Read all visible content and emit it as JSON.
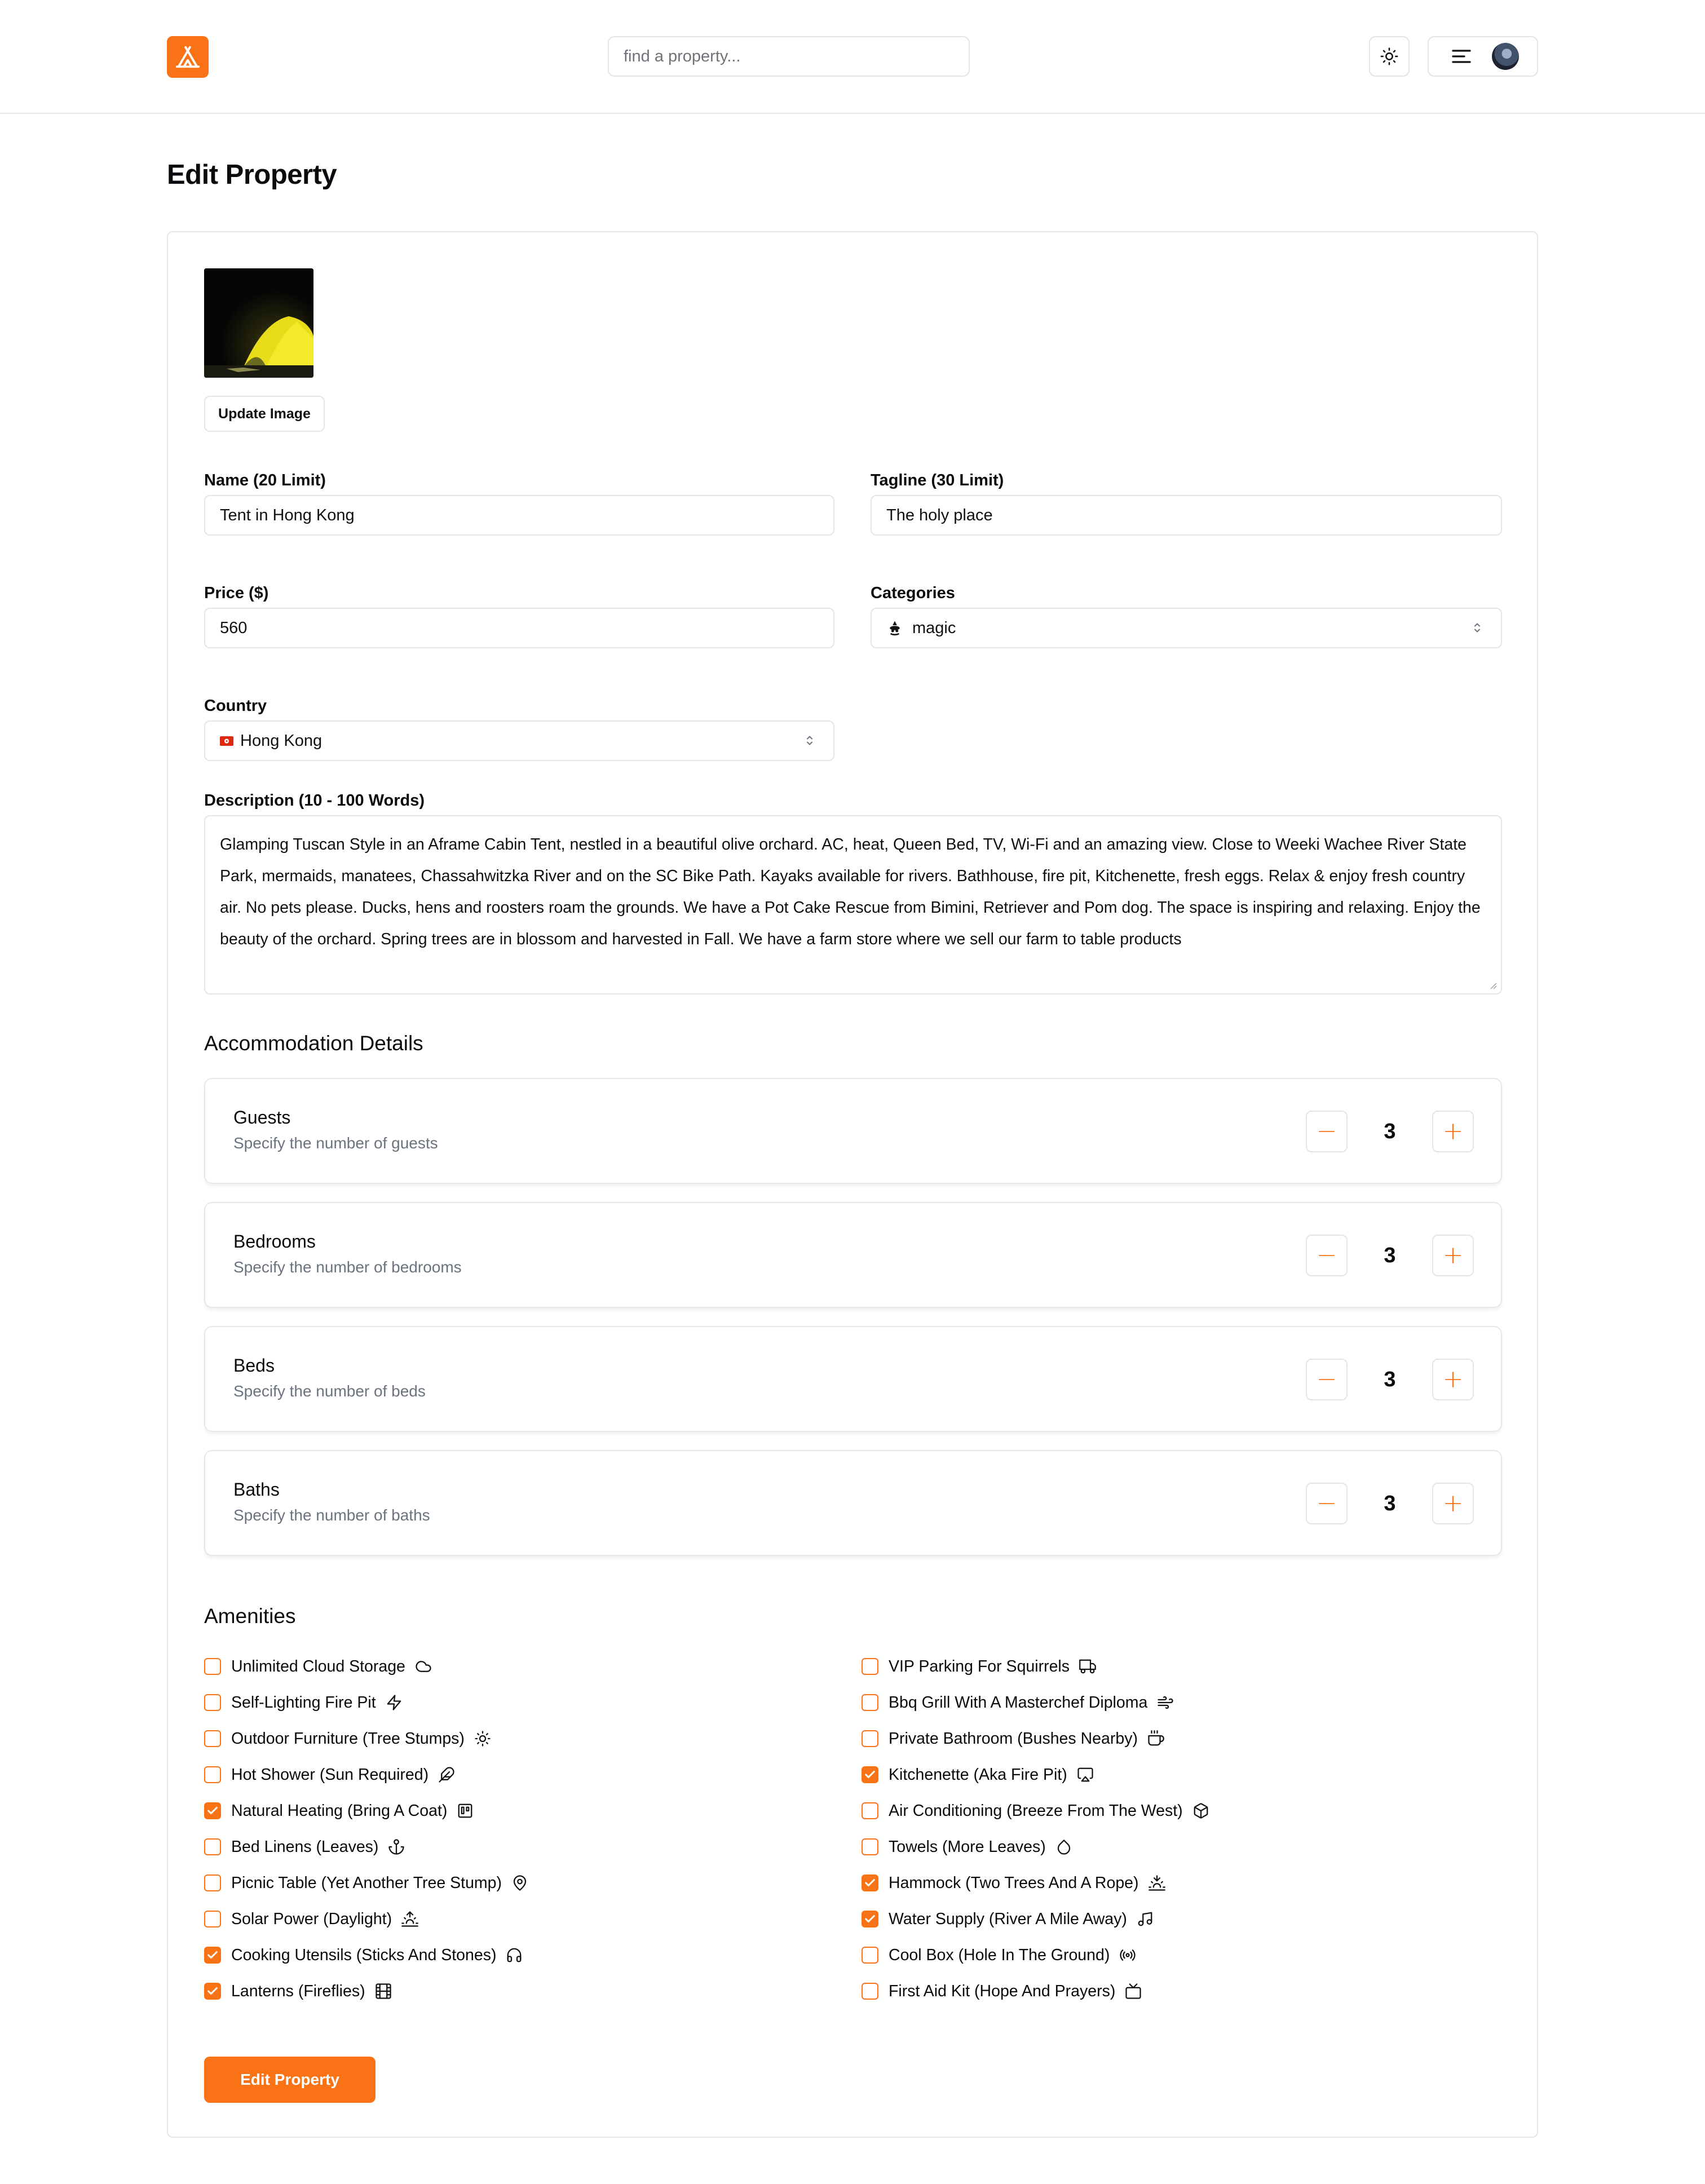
{
  "header": {
    "search_placeholder": "find a property..."
  },
  "page": {
    "title": "Edit Property"
  },
  "form": {
    "update_image_label": "Update Image",
    "name": {
      "label": "Name (20 Limit)",
      "value": "Tent in Hong Kong"
    },
    "tagline": {
      "label": "Tagline (30 Limit)",
      "value": "The holy place"
    },
    "price": {
      "label": "Price ($)",
      "value": "560"
    },
    "categories": {
      "label": "Categories",
      "value": "magic"
    },
    "country": {
      "label": "Country",
      "value": "Hong Kong",
      "flag": "🇭🇰"
    },
    "description": {
      "label": "Description (10 - 100 Words)",
      "value": "Glamping Tuscan Style in an Aframe Cabin Tent, nestled in a beautiful olive orchard. AC, heat, Queen Bed, TV, Wi-Fi and an amazing view. Close to Weeki Wachee River State Park, mermaids, manatees, Chassahwitzka River and on the SC Bike Path. Kayaks available for rivers. Bathhouse, fire pit, Kitchenette, fresh eggs. Relax & enjoy fresh country air. No pets please. Ducks, hens and roosters roam the grounds. We have a Pot Cake Rescue from Bimini, Retriever and Pom dog. The space is inspiring and relaxing. Enjoy the beauty of the orchard. Spring trees are in blossom and harvested in Fall. We have a farm store where we sell our farm to table products"
    },
    "accommodation": {
      "title": "Accommodation Details",
      "items": [
        {
          "title": "Guests",
          "subtitle": "Specify the number of guests",
          "value": "3"
        },
        {
          "title": "Bedrooms",
          "subtitle": "Specify the number of bedrooms",
          "value": "3"
        },
        {
          "title": "Beds",
          "subtitle": "Specify the number of beds",
          "value": "3"
        },
        {
          "title": "Baths",
          "subtitle": "Specify the number of baths",
          "value": "3"
        }
      ]
    },
    "amenities": {
      "title": "Amenities",
      "left": [
        {
          "label": "Unlimited Cloud Storage",
          "checked": false,
          "icon": "cloud-icon"
        },
        {
          "label": "Self-Lighting Fire Pit",
          "checked": false,
          "icon": "zap-icon"
        },
        {
          "label": "Outdoor Furniture (Tree Stumps)",
          "checked": false,
          "icon": "sun-icon"
        },
        {
          "label": "Hot Shower (Sun Required)",
          "checked": false,
          "icon": "feather-icon"
        },
        {
          "label": "Natural Heating (Bring A Coat)",
          "checked": true,
          "icon": "trello-icon"
        },
        {
          "label": "Bed Linens (Leaves)",
          "checked": false,
          "icon": "anchor-icon"
        },
        {
          "label": "Picnic Table (Yet Another Tree Stump)",
          "checked": false,
          "icon": "map-pin-icon"
        },
        {
          "label": "Solar Power (Daylight)",
          "checked": false,
          "icon": "sunrise-icon"
        },
        {
          "label": "Cooking Utensils (Sticks And Stones)",
          "checked": true,
          "icon": "headphones-icon"
        },
        {
          "label": "Lanterns (Fireflies)",
          "checked": true,
          "icon": "film-icon"
        }
      ],
      "right": [
        {
          "label": "VIP Parking For Squirrels",
          "checked": false,
          "icon": "truck-icon"
        },
        {
          "label": "Bbq Grill With A Masterchef Diploma",
          "checked": false,
          "icon": "wind-icon"
        },
        {
          "label": "Private Bathroom (Bushes Nearby)",
          "checked": false,
          "icon": "coffee-icon"
        },
        {
          "label": "Kitchenette (Aka Fire Pit)",
          "checked": true,
          "icon": "airplay-icon"
        },
        {
          "label": "Air Conditioning (Breeze From The West)",
          "checked": false,
          "icon": "box-icon"
        },
        {
          "label": "Towels (More Leaves)",
          "checked": false,
          "icon": "droplet-icon"
        },
        {
          "label": "Hammock (Two Trees And A Rope)",
          "checked": true,
          "icon": "sunset-icon"
        },
        {
          "label": "Water Supply (River A Mile Away)",
          "checked": true,
          "icon": "music-icon"
        },
        {
          "label": "Cool Box (Hole In The Ground)",
          "checked": false,
          "icon": "radio-icon"
        },
        {
          "label": "First Aid Kit (Hope And Prayers)",
          "checked": false,
          "icon": "tv-icon"
        }
      ]
    },
    "submit_label": "Edit Property"
  },
  "colors": {
    "accent": "#f97316",
    "border": "#e4e4e7",
    "muted": "#6b7280"
  }
}
